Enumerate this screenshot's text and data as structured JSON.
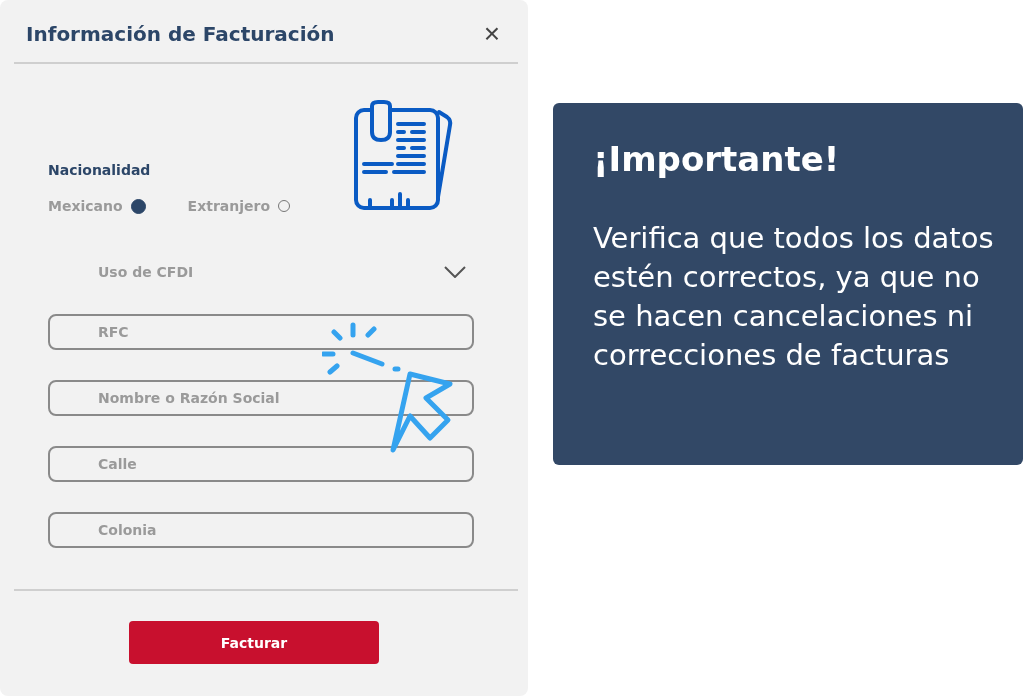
{
  "dialog": {
    "title": "Información de Facturación",
    "close": "×"
  },
  "nationality": {
    "label": "Nacionalidad",
    "options": [
      {
        "label": "Mexicano",
        "selected": true
      },
      {
        "label": "Extranjero",
        "selected": false
      }
    ]
  },
  "cfdi": {
    "placeholder": "Uso de CFDI"
  },
  "fields": [
    {
      "placeholder": "RFC"
    },
    {
      "placeholder": "Nombre o Razón Social"
    },
    {
      "placeholder": "Calle"
    },
    {
      "placeholder": "Colonia"
    }
  ],
  "submit": "Facturar",
  "notice": {
    "title": "¡Importante!",
    "body": "Verifica que todos los datos estén correctos, ya que no se hacen cancelaciones ni correcciones de facturas"
  }
}
